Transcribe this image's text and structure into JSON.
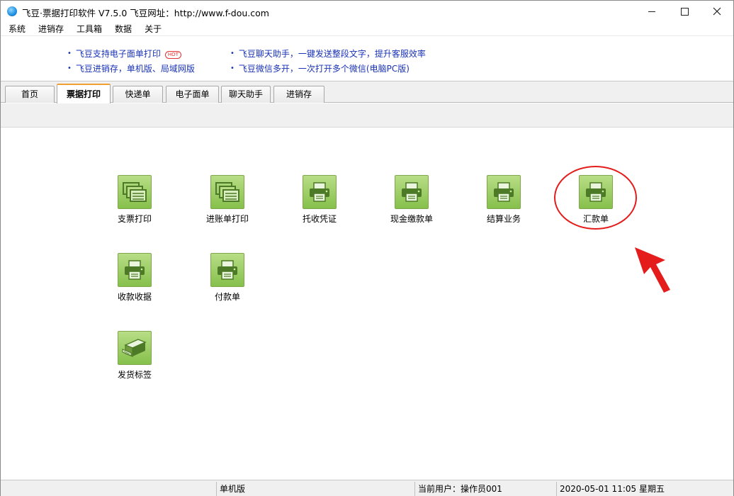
{
  "window": {
    "title": "飞豆·票据打印软件 V7.5.0  飞豆网址：http://www.f-dou.com"
  },
  "menu": [
    "系统",
    "进销存",
    "工具箱",
    "数据",
    "关于"
  ],
  "promo": {
    "links": [
      {
        "text": "飞豆支持电子面单打印",
        "hot": "HOT"
      },
      {
        "text": "飞豆进销存，单机版、局域网版"
      },
      {
        "text": "飞豆聊天助手，一键发送整段文字，提升客服效率"
      },
      {
        "text": "飞豆微信多开，一次打开多个微信(电脑PC版)"
      }
    ]
  },
  "tabs": [
    {
      "label": "首页",
      "active": false
    },
    {
      "label": "票据打印",
      "active": true
    },
    {
      "label": "快递单",
      "active": false
    },
    {
      "label": "电子面单",
      "active": false
    },
    {
      "label": "聊天助手",
      "active": false
    },
    {
      "label": "进销存",
      "active": false
    }
  ],
  "tools": [
    {
      "label": "支票打印",
      "icon": "documents-icon"
    },
    {
      "label": "进账单打印",
      "icon": "documents-icon"
    },
    {
      "label": "托收凭证",
      "icon": "printer-icon"
    },
    {
      "label": "现金缴款单",
      "icon": "printer-icon"
    },
    {
      "label": "结算业务",
      "icon": "printer-icon"
    },
    {
      "label": "汇款单",
      "icon": "printer-icon",
      "highlighted": true
    },
    {
      "label": "收款收据",
      "icon": "printer-icon"
    },
    {
      "label": "付款单",
      "icon": "printer-icon"
    },
    {
      "label": "发货标签",
      "icon": "label-printer-icon"
    }
  ],
  "status": {
    "edition": "单机版",
    "user": "当前用户：操作员001",
    "datetime": "2020-05-01  11:05 星期五"
  },
  "colors": {
    "link": "#1a33b5",
    "tool_green": "#86c04c",
    "highlight_red": "#e41c1c"
  }
}
